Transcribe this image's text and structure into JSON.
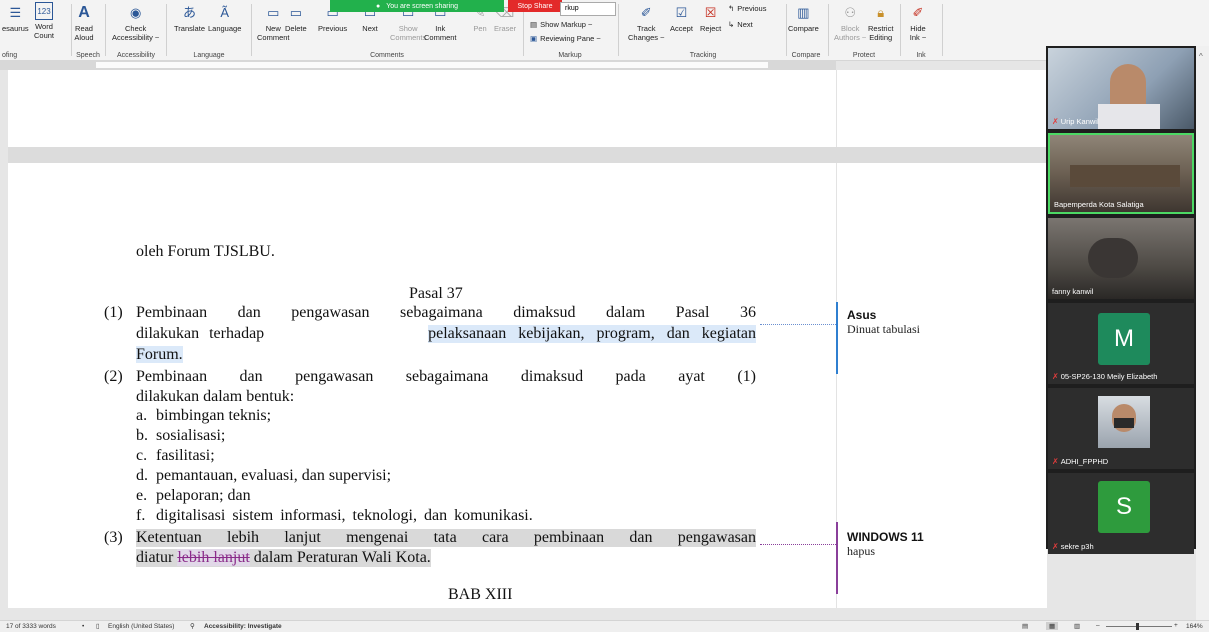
{
  "ribbon": {
    "share_banner": "You are screen sharing",
    "stop_share": "Stop Share",
    "groups": {
      "proofing": "ofing",
      "speech": "Speech",
      "accessibility": "Accessibility",
      "language": "Language",
      "comments": "Comments",
      "markup": "Markup",
      "tracking": "Tracking",
      "compare": "Compare",
      "protect": "Protect",
      "ink": "Ink"
    },
    "buttons": {
      "thesaurus": "esaurus",
      "word_count": "Word\nCount",
      "read_aloud": "Read\nAloud",
      "check_accessibility": "Check\nAccessibility ~",
      "translate": "Translate",
      "language": "Language",
      "new_comment": "New\nComment",
      "delete": "Delete",
      "previous_comment": "Previous",
      "next_comment": "Next",
      "show_comments": "Show\nComments",
      "ink_comment": "Ink\nComment",
      "pen": "Pen",
      "eraser": "Eraser",
      "markup_dropdown": "rkup",
      "show_markup": "Show Markup ~",
      "reviewing_pane": "Reviewing Pane ~",
      "track_changes": "Track\nChanges ~",
      "accept": "Accept",
      "reject": "Reject",
      "previous_change": "Previous",
      "next_change": "Next",
      "compare": "Compare",
      "block_authors": "Block\nAuthors ~",
      "restrict_editing": "Restrict\nEditing",
      "hide_ink": "Hide\nInk ~"
    }
  },
  "document": {
    "line_forum": "oleh Forum TJSLBU.",
    "pasal_title": "Pasal 37",
    "item1_num": "(1)",
    "item1_line1": "Pembinaan dan pengawasan sebagaimana dimaksud dalam Pasal 36",
    "item1_line2a": "dilakukan terhadap ",
    "item1_line2b": "pelaksanaan kebijakan, program, dan kegiatan",
    "item1_line3": "Forum.",
    "item2_num": "(2)",
    "item2_line1": "Pembinaan dan pengawasan sebagaimana dimaksud pada ayat (1)",
    "item2_line2": "dilakukan dalam bentuk:",
    "subitems": [
      {
        "letter": "a.",
        "text": "bimbingan teknis;"
      },
      {
        "letter": "b.",
        "text": "sosialisasi;"
      },
      {
        "letter": "c.",
        "text": "fasilitasi;"
      },
      {
        "letter": "d.",
        "text": "pemantauan, evaluasi, dan supervisi;"
      },
      {
        "letter": "e.",
        "text": "pelaporan; dan"
      },
      {
        "letter": "f.",
        "text": "digitalisasi sistem informasi, teknologi, dan komunikasi."
      }
    ],
    "item3_num": "(3)",
    "item3_line1": "Ketentuan lebih lanjut mengenai tata cara pembinaan dan pengawasan",
    "item3_line2a": "diatur ",
    "item3_line2b": "lebih lanjut",
    "item3_line2c": " dalam Peraturan Wali Kota.",
    "bab_title": "BAB XIII"
  },
  "comments": [
    {
      "author": "Asus",
      "text": "Dinuat tabulasi",
      "color": "#2f7fd0"
    },
    {
      "author": "WINDOWS 11",
      "text": "hapus",
      "color": "#8a3f9a"
    }
  ],
  "participants": [
    {
      "name": "Urip Kanwil",
      "muted": true,
      "type": "video",
      "bg": "#8ea0b4"
    },
    {
      "name": "Bapemperda Kota Salatiga",
      "muted": false,
      "type": "video",
      "bg": "#6b5f52",
      "active": true
    },
    {
      "name": "fanny kanwil",
      "muted": false,
      "type": "video",
      "bg": "#4e4a45"
    },
    {
      "name": "05-SP26-130 Meily Elizabeth",
      "muted": true,
      "type": "avatar",
      "initial": "M",
      "bg": "#1e8a5c"
    },
    {
      "name": "ADHI_FPPHD",
      "muted": true,
      "type": "video",
      "bg": "#9aa3ad"
    },
    {
      "name": "sekre p3h",
      "muted": true,
      "type": "avatar",
      "initial": "S",
      "bg": "#2e9b3d"
    }
  ],
  "status": {
    "words": "17 of 3333 words",
    "language": "English (United States)",
    "accessibility": "Accessibility: Investigate",
    "zoom": "164%"
  }
}
